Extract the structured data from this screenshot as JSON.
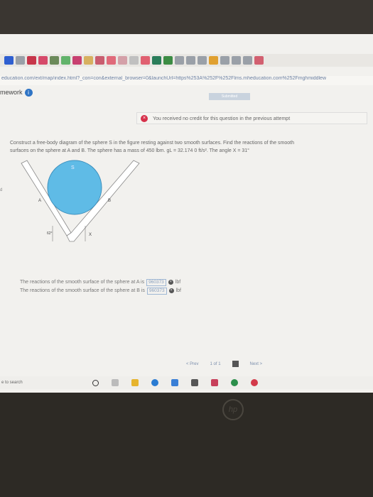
{
  "browser": {
    "url": "education.com/ext/map/index.html?_con=con&external_browser=0&launchUrl=https%253A%252F%252Flms.mheducation.com%252Fmghmiddlew",
    "tab_colors": [
      "#2f5fd0",
      "#9aa0a8",
      "#c7364a",
      "#d64a6a",
      "#6c8a5a",
      "#62b36b",
      "#c84070",
      "#d7b060",
      "#c95d6f",
      "#e06a7a",
      "#d4a0a8",
      "#c0c0c0",
      "#e06070",
      "#2a7d5a",
      "#3c8c44",
      "#9aa0a8",
      "#9aa0a8",
      "#9aa0a8",
      "#e0a030",
      "#9aa0a8",
      "#9aa0a8",
      "#9aa0a8",
      "#d26070"
    ]
  },
  "header": {
    "homework_label": "mework",
    "info_icon": "i",
    "submitted_label": "Submitted"
  },
  "alert": {
    "icon": "×",
    "message": "You received no credit for this question in the previous attempt"
  },
  "problem": {
    "text_line1": "Construct a free-body diagram of the sphere S in the figure resting against two smooth surfaces. Find the reactions of the smooth",
    "text_line2": "surfaces on the sphere at A and B. The sphere has a mass of 450 lbm. gL = 32.174 0 ft/s². The angle X = 31°"
  },
  "figure": {
    "sphere_label": "S",
    "point_a": "A",
    "point_b": "B",
    "angle_left": "62°",
    "angle_x": "X",
    "side_label": "d"
  },
  "answers": {
    "row_a_label": "The reactions of the smooth surface of the sphere at A is",
    "row_a_value": "960373",
    "row_a_unit": "lbf",
    "row_b_label": "The reactions of the smooth surface of the sphere at B is",
    "row_b_value": "960373",
    "row_b_unit": "lbf"
  },
  "nav": {
    "prev": "< Prev",
    "page": "1 of 1",
    "next": "Next >"
  },
  "taskbar": {
    "search": "e to search"
  },
  "brand": "hp"
}
